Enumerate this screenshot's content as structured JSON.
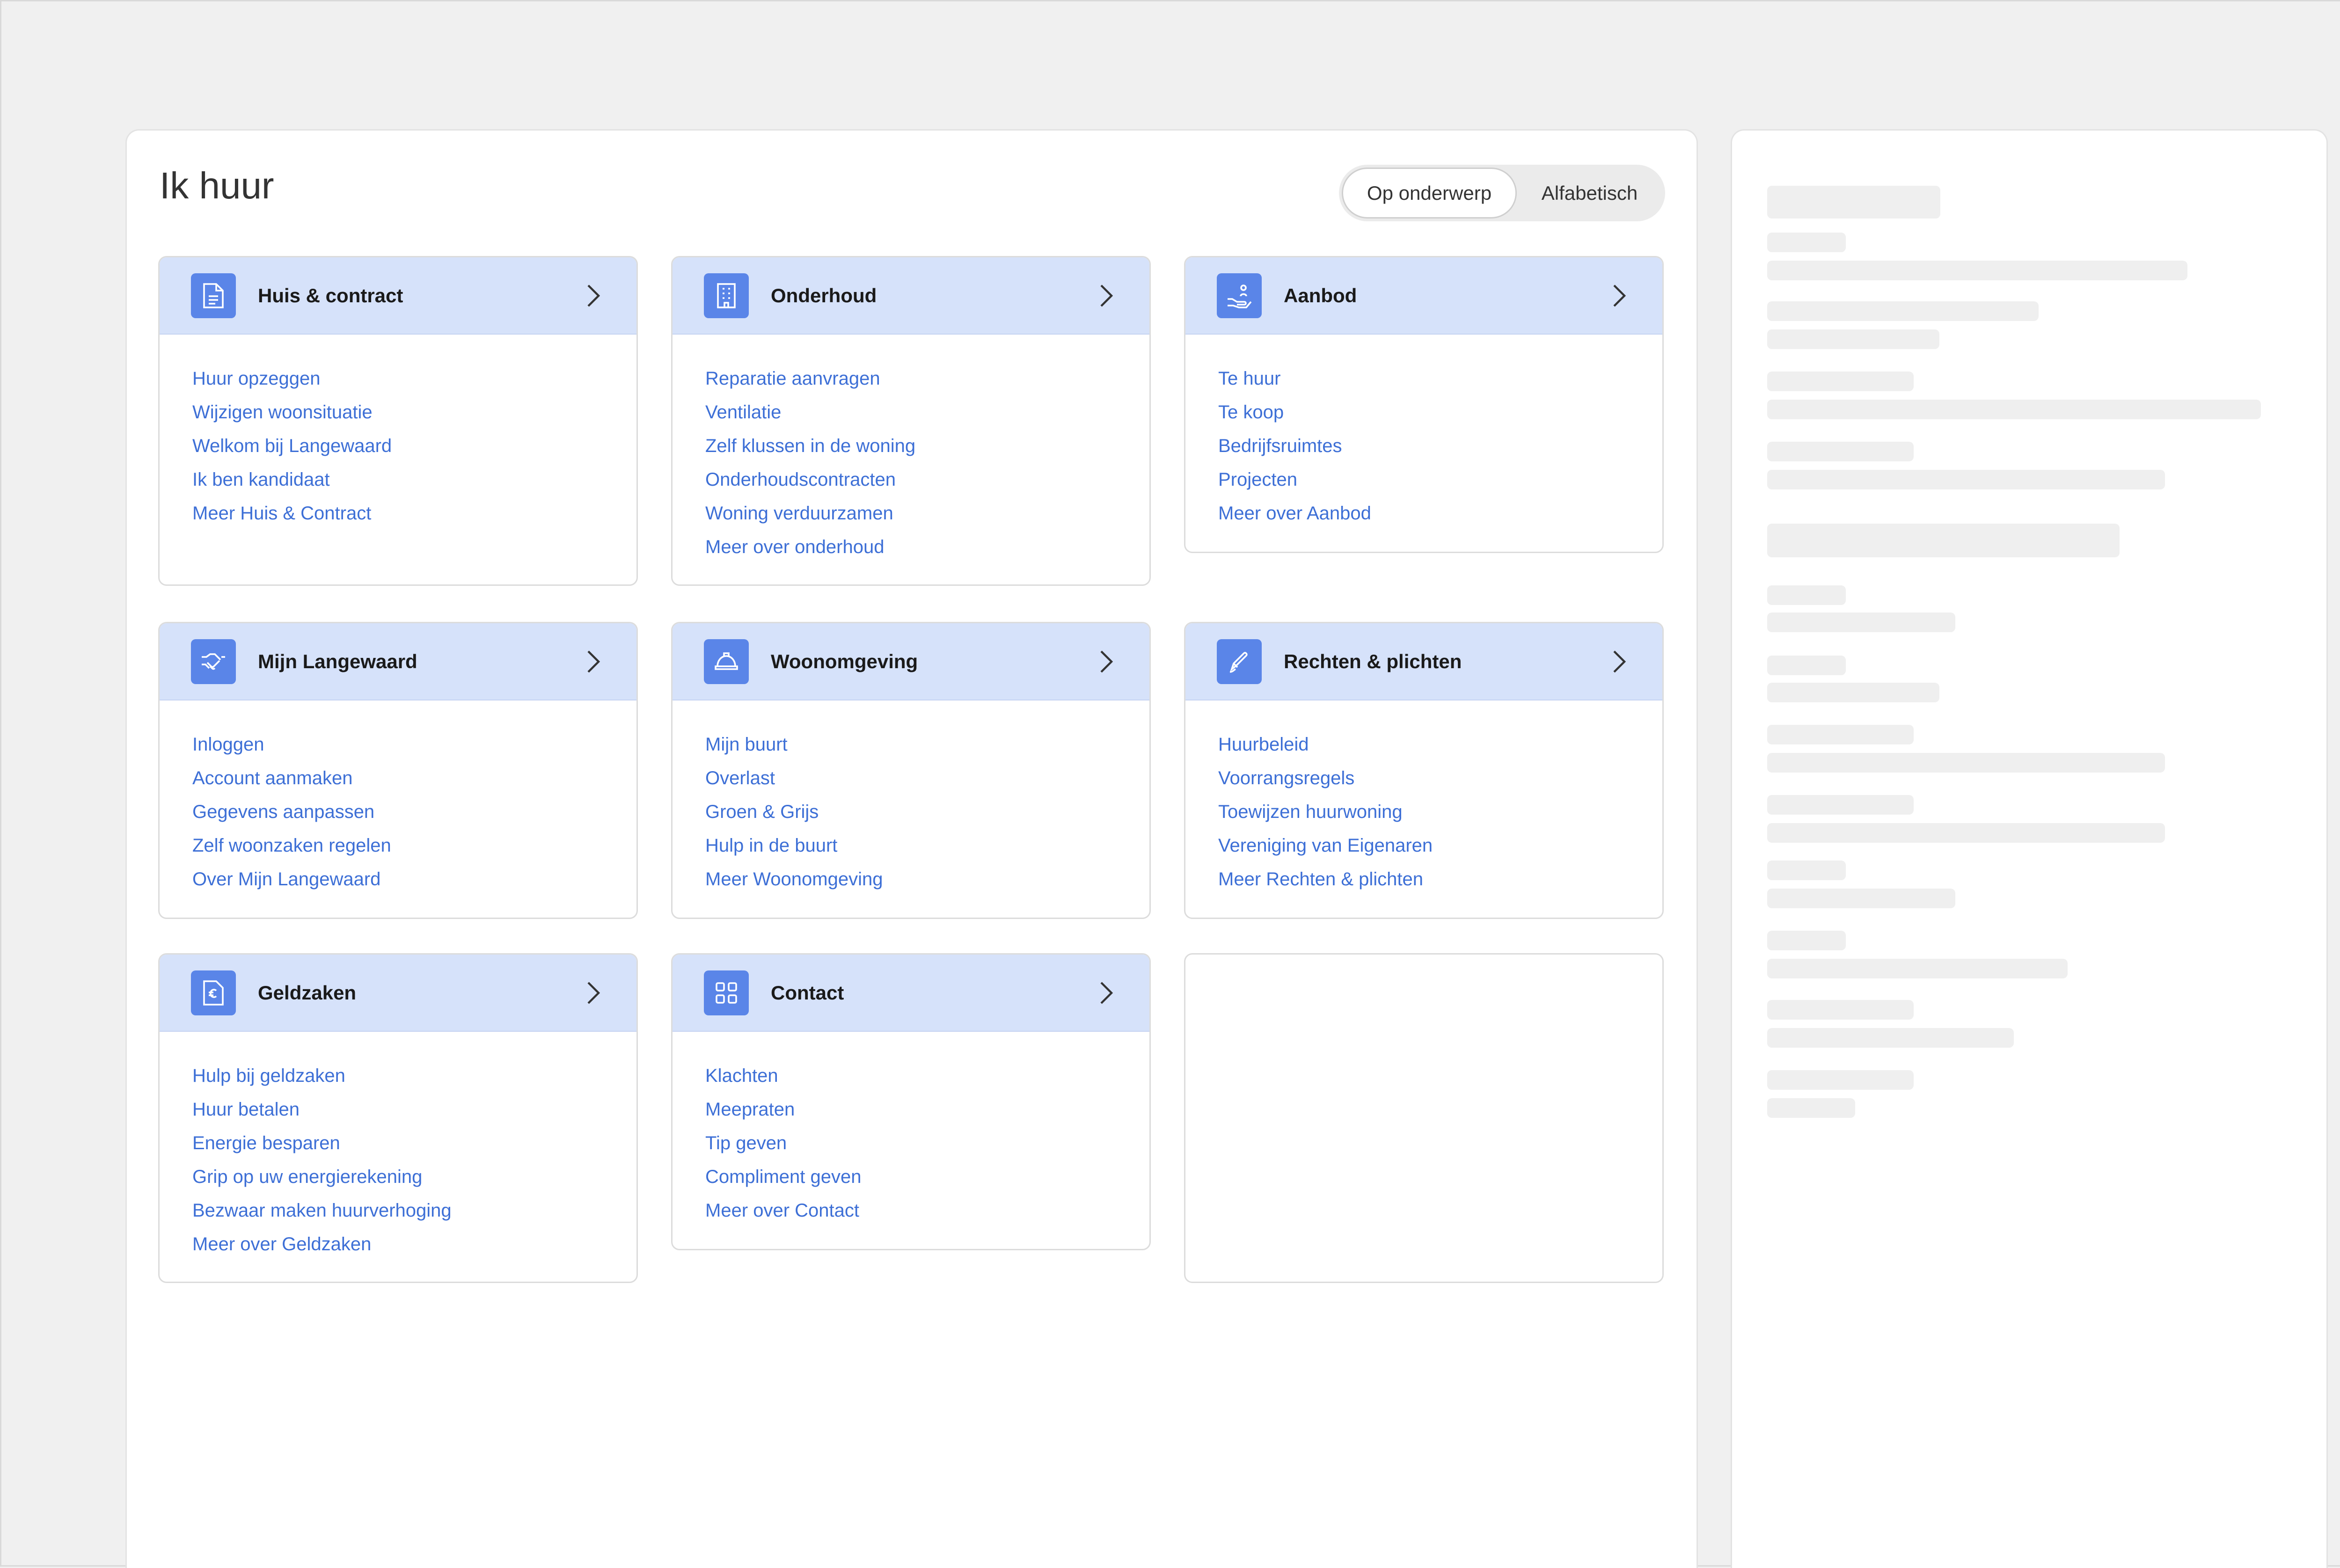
{
  "page": {
    "title": "Ik huur",
    "view_toggle": {
      "options": [
        "Op onderwerp",
        "Alfabetisch"
      ],
      "selected": "Op onderwerp"
    }
  },
  "colors": {
    "background": "#f0f0f0",
    "card_header": "#d6e2fa",
    "icon_tile": "#5a85e8",
    "link": "#3d6fd6",
    "skeleton": "#efefef"
  },
  "categories": [
    {
      "title": "Huis & contract",
      "icon": "document-icon",
      "links": [
        "Huur opzeggen",
        "Wijzigen woonsituatie",
        "Welkom bij Langewaard",
        "Ik ben kandidaat",
        "Meer Huis & Contract"
      ]
    },
    {
      "title": "Onderhoud",
      "icon": "building-icon",
      "links": [
        "Reparatie aanvragen",
        "Ventilatie",
        "Zelf klussen in de woning",
        "Onderhoudscontracten",
        "Woning verduurzamen",
        "Meer over onderhoud"
      ]
    },
    {
      "title": "Aanbod",
      "icon": "hand-person-icon",
      "links": [
        "Te huur",
        "Te koop",
        "Bedrijfsruimtes",
        "Projecten",
        "Meer over Aanbod"
      ]
    },
    {
      "title": "Mijn Langewaard",
      "icon": "handshake-icon",
      "links": [
        "Inloggen",
        "Account aanmaken",
        "Gegevens aanpassen",
        "Zelf woonzaken regelen",
        "Over Mijn Langewaard"
      ]
    },
    {
      "title": "Woonomgeving",
      "icon": "hard-hat-icon",
      "links": [
        "Mijn buurt",
        "Overlast",
        "Groen & Grijs",
        "Hulp in de buurt",
        "Meer Woonomgeving"
      ]
    },
    {
      "title": "Rechten & plichten",
      "icon": "pen-icon",
      "links": [
        "Huurbeleid",
        "Voorrangsregels",
        "Toewijzen huurwoning",
        "Vereniging van Eigenaren",
        "Meer Rechten & plichten"
      ]
    },
    {
      "title": "Geldzaken",
      "icon": "euro-document-icon",
      "links": [
        "Hulp bij geldzaken",
        "Huur betalen",
        "Energie besparen",
        "Grip op uw energierekening",
        "Bezwaar maken huurverhoging",
        "Meer over Geldzaken"
      ]
    },
    {
      "title": "Contact",
      "icon": "grid-icon",
      "links": [
        "Klachten",
        "Meepraten",
        "Tip geven",
        "Compliment geven",
        "Meer over Contact"
      ]
    }
  ]
}
